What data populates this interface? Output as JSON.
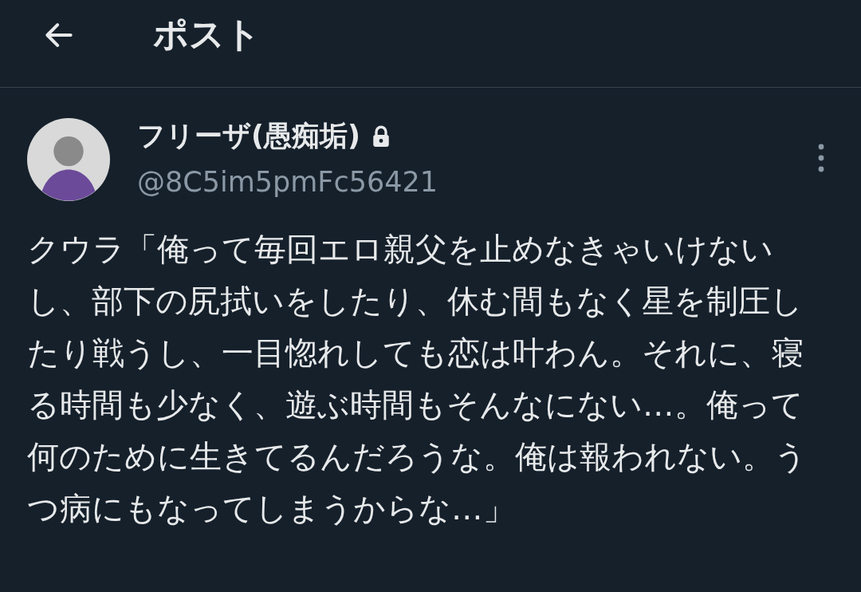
{
  "header": {
    "title": "ポスト"
  },
  "post": {
    "author": {
      "name": "フリーザ(愚痴垢)",
      "handle": "@8C5im5pmFc56421",
      "protected": true
    },
    "text": "クウラ「俺って毎回エロ親父を止めなきゃいけないし、部下の尻拭いをしたり、休む間もなく星を制圧したり戦うし、一目惚れしても恋は叶わん。それに、寝る時間も少なく、遊ぶ時間もそんなにない…。俺って何のために生きてるんだろうな。俺は報われない。うつ病にもなってしまうからな…」"
  }
}
